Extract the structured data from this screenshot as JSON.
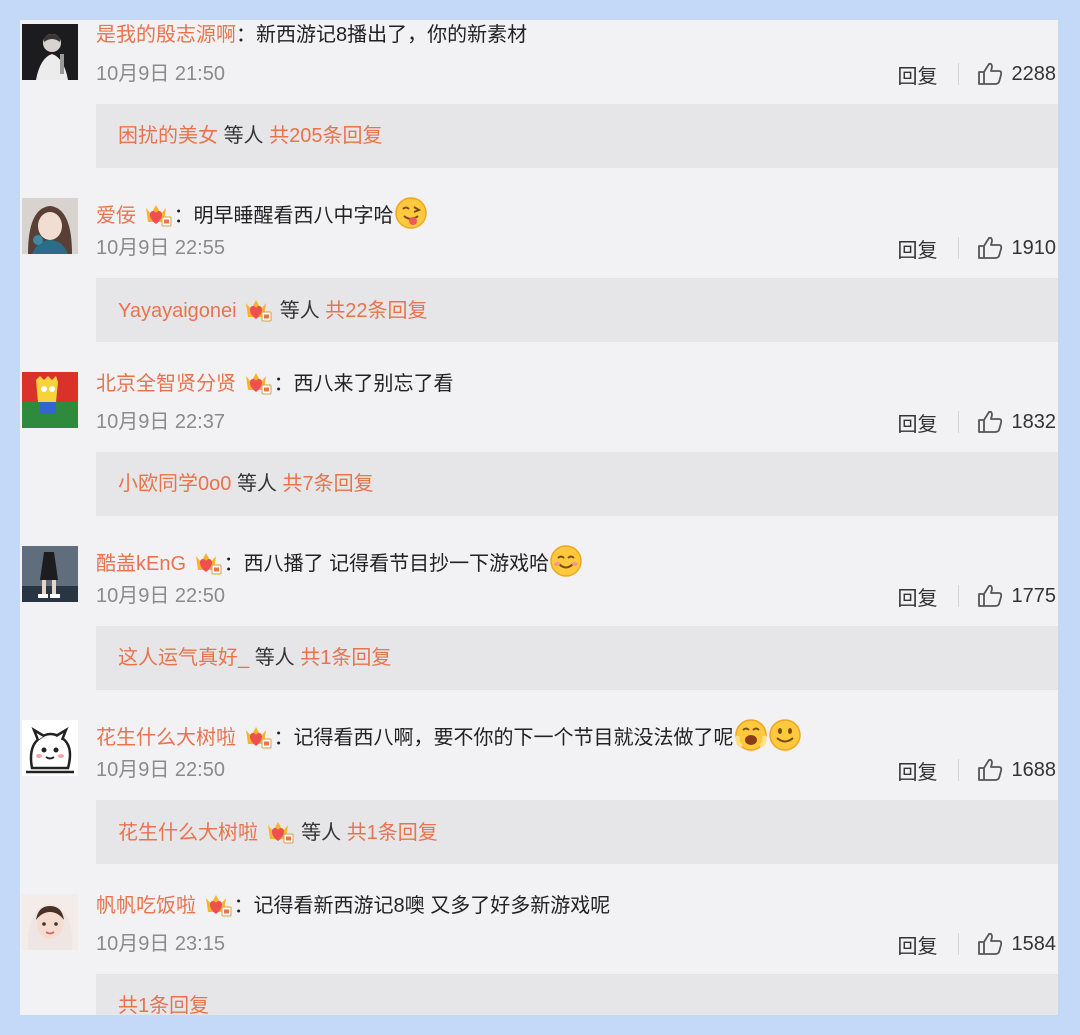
{
  "comments": [
    {
      "username": "是我的殷志源啊",
      "vip": false,
      "text": "：新西游记8播出了，你的新素材",
      "emojis": [],
      "time": "10月9日 21:50",
      "reply_label": "回复",
      "likes": "2288",
      "replies": {
        "name": "困扰的美女",
        "vip": false,
        "others": "等人",
        "total": "共205条回复"
      }
    },
    {
      "username": "爱佞",
      "vip": true,
      "text": "：明早睡醒看西八中字哈",
      "emojis": [
        "tongue-emoji"
      ],
      "time": "10月9日 22:55",
      "reply_label": "回复",
      "likes": "1910",
      "replies": {
        "name": "Yayayaigonei",
        "vip": true,
        "others": "等人",
        "total": "共22条回复"
      }
    },
    {
      "username": "北京全智贤分贤",
      "vip": true,
      "text": "：西八来了别忘了看",
      "emojis": [],
      "time": "10月9日 22:37",
      "reply_label": "回复",
      "likes": "1832",
      "replies": {
        "name": "小欧同学0o0",
        "vip": false,
        "others": "等人",
        "total": "共7条回复"
      }
    },
    {
      "username": "酷盖kEnG",
      "vip": true,
      "text": "：西八播了 记得看节目抄一下游戏哈",
      "emojis": [
        "smile-emoji"
      ],
      "time": "10月9日 22:50",
      "reply_label": "回复",
      "likes": "1775",
      "replies": {
        "name": "这人运气真好_",
        "vip": false,
        "others": "等人",
        "total": "共1条回复"
      }
    },
    {
      "username": "花生什么大树啦",
      "vip": true,
      "text": "：记得看西八啊，要不你的下一个节目就没法做了呢",
      "emojis": [
        "scared-emoji",
        "smile-emoji"
      ],
      "time": "10月9日 22:50",
      "reply_label": "回复",
      "likes": "1688",
      "replies": {
        "name": "花生什么大树啦",
        "vip": true,
        "others": "等人",
        "total": "共1条回复"
      }
    },
    {
      "username": "帆帆吃饭啦",
      "vip": true,
      "text": "：记得看新西游记8噢 又多了好多新游戏呢",
      "emojis": [],
      "time": "10月9日 23:15",
      "reply_label": "回复",
      "likes": "1584",
      "replies": {
        "name": "",
        "vip": false,
        "others": "",
        "total": "共1条回复"
      }
    }
  ],
  "colors": {
    "page_background": "#c3d9f7",
    "panel_background": "#f2f2f4",
    "reply_box": "#e6e6e8",
    "username_orange": "#e8734d",
    "meta_gray": "#8a8a8a"
  },
  "icons": {
    "like": "thumbs-up-icon",
    "vip": "crown-heart-badge-icon"
  }
}
